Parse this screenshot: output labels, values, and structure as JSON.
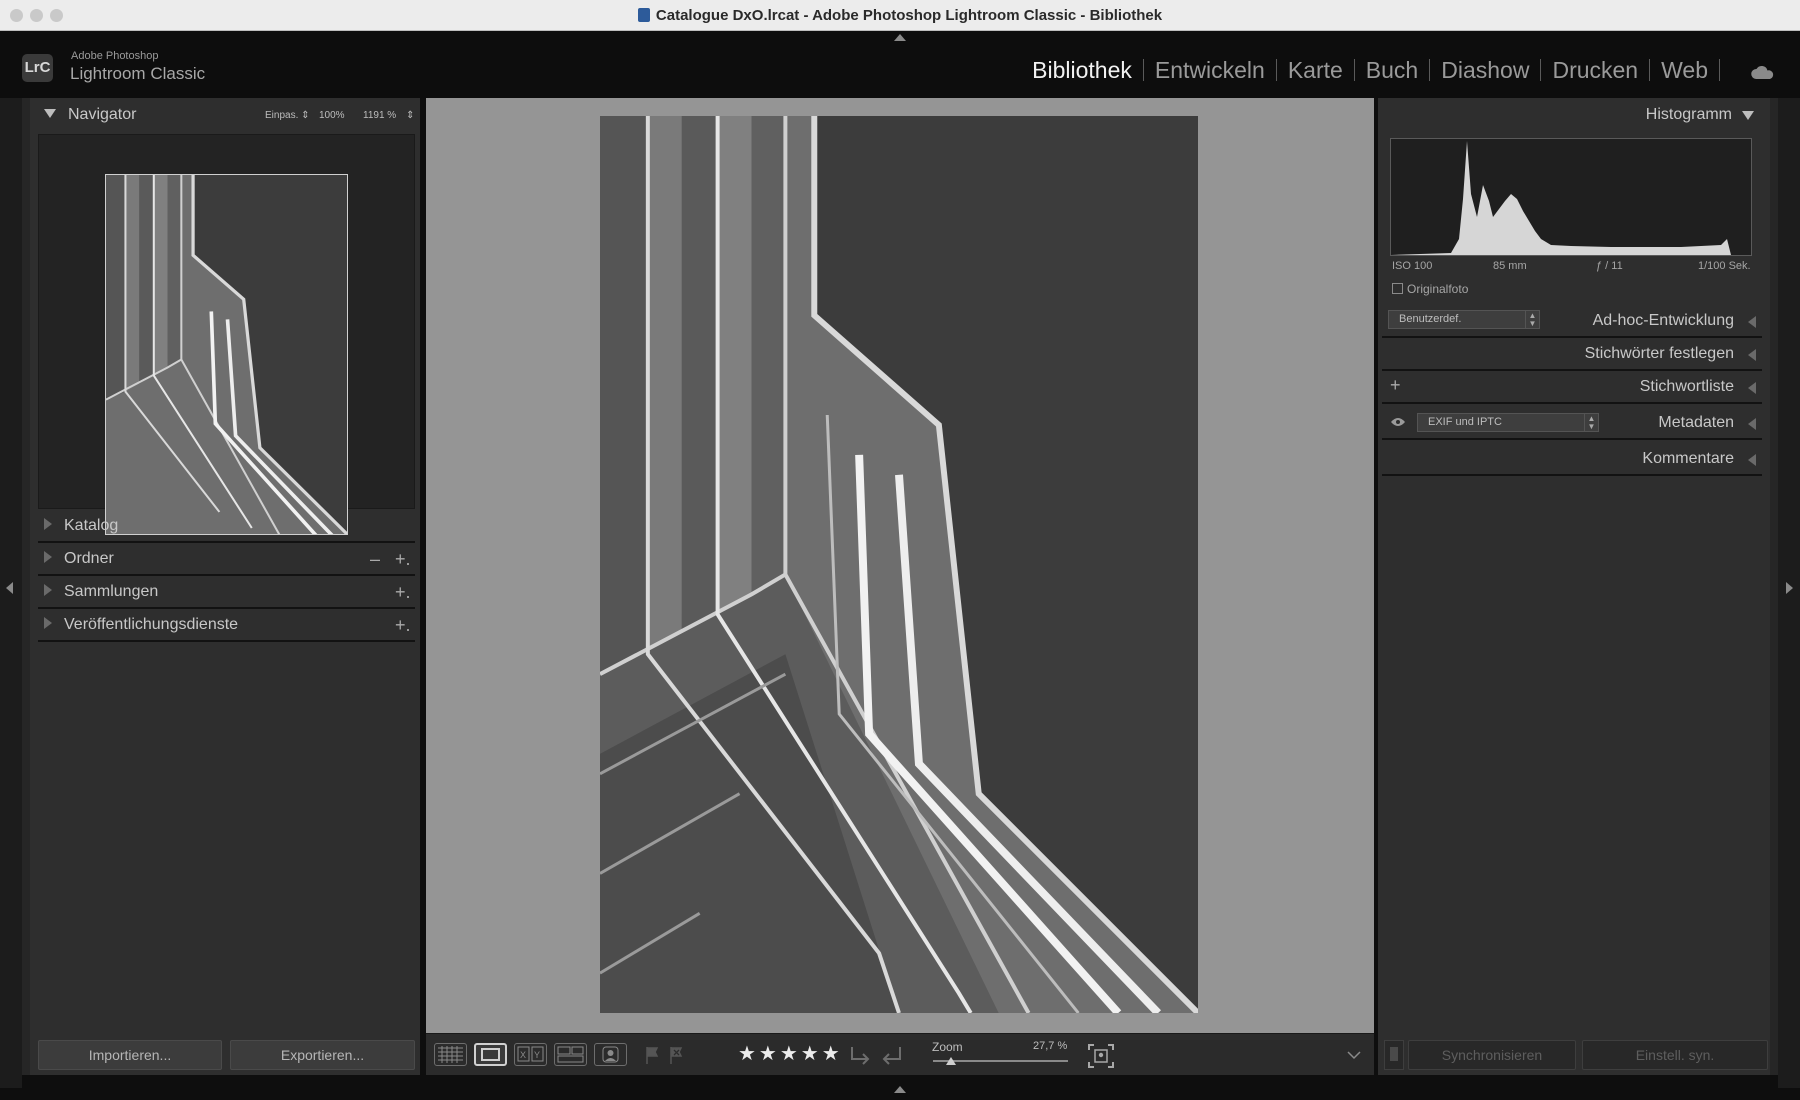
{
  "window": {
    "title": "Catalogue DxO.lrcat - Adobe Photoshop Lightroom Classic - Bibliothek"
  },
  "brand": {
    "logo": "LrC",
    "line1": "Adobe Photoshop",
    "line2": "Lightroom Classic"
  },
  "modules": [
    "Bibliothek",
    "Entwickeln",
    "Karte",
    "Buch",
    "Diashow",
    "Drucken",
    "Web"
  ],
  "active_module": "Bibliothek",
  "left": {
    "navigator": {
      "label": "Navigator",
      "opt_fit": "Einpas.",
      "opt_100": "100%",
      "opt_zoom": "1191 %"
    },
    "sections": [
      {
        "label": "Katalog",
        "actions": []
      },
      {
        "label": "Ordner",
        "actions": [
          "–",
          "+."
        ]
      },
      {
        "label": "Sammlungen",
        "actions": [
          "+."
        ]
      },
      {
        "label": "Veröffentlichungsdienste",
        "actions": [
          "+."
        ]
      }
    ],
    "import_label": "Importieren...",
    "export_label": "Exportieren..."
  },
  "toolbar": {
    "stars": "★★★★★",
    "zoom_label": "Zoom",
    "zoom_value": "27,7 %",
    "zoom_level": 0.13
  },
  "right": {
    "histogram": {
      "label": "Histogramm",
      "iso": "ISO 100",
      "focal": "85 mm",
      "aperture": "ƒ / 11",
      "shutter": "1/100 Sek.",
      "original_label": "Originalfoto"
    },
    "quick_develop": {
      "preset": "Benutzerdef.",
      "label": "Ad-hoc-Entwicklung"
    },
    "keywording": {
      "label": "Stichwörter festlegen"
    },
    "keyword_list": {
      "label": "Stichwortliste",
      "add": "+"
    },
    "metadata": {
      "preset": "EXIF und IPTC",
      "label": "Metadaten"
    },
    "comments": {
      "label": "Kommentare"
    },
    "sync_label": "Synchronisieren",
    "sync_settings_label": "Einstell. syn."
  },
  "colors": {
    "background": "#0e0e0e",
    "panel": "#2e2e2e",
    "canvas": "#959595",
    "active_module": "#f2f2f2"
  }
}
